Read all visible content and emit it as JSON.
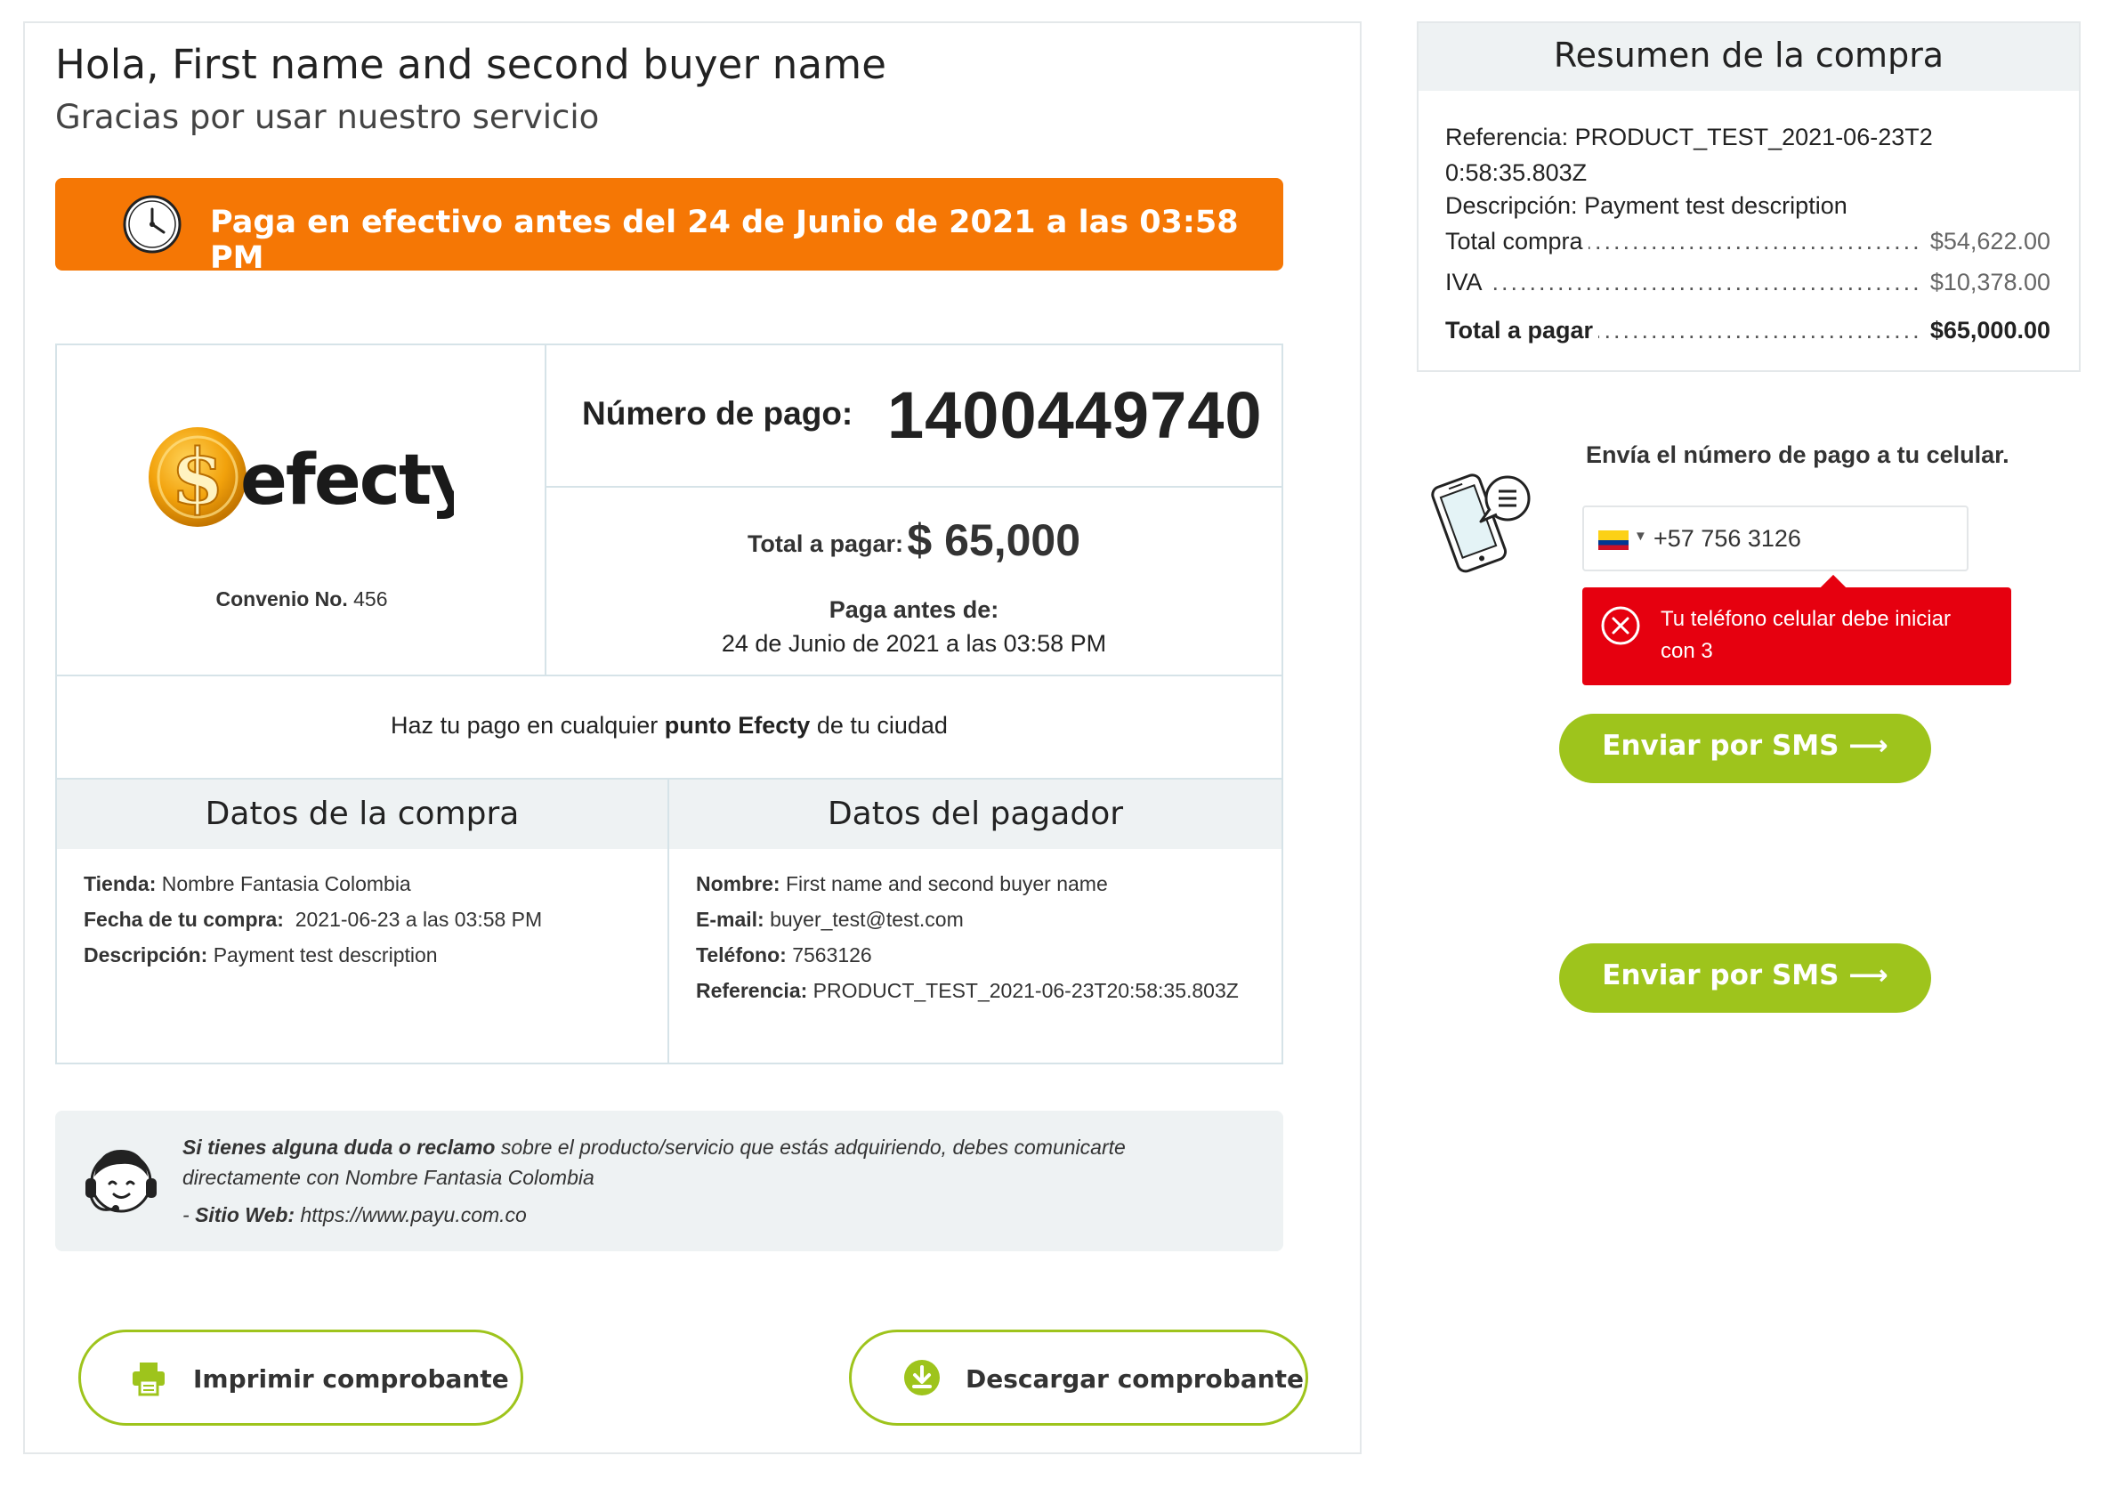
{
  "greeting": {
    "title": "Hola, First name and second buyer name",
    "subtitle": "Gracias por usar nuestro servicio"
  },
  "deadline": {
    "text": "Paga en efectivo antes del 24 de Junio de 2021 a las 03:58 PM",
    "color": "#f57705",
    "icon": "clock-icon"
  },
  "payment": {
    "logo_text": "efecty",
    "convenio_label": "Convenio No.",
    "convenio_value": "456",
    "numero_label": "Número de pago:",
    "numero_value": "1400449740",
    "total_label": "Total a pagar:",
    "total_value": "$ 65,000",
    "paga_antes_label": "Paga antes de:",
    "paga_antes_value": "24 de Junio de 2021 a las 03:58 PM",
    "where_pre": "Haz tu pago en cualquier",
    "where_bold": "punto Efecty",
    "where_post": "de tu ciudad"
  },
  "compra": {
    "title": "Datos de la compra",
    "rows": [
      {
        "label": "Tienda:",
        "value": "Nombre Fantasia Colombia"
      },
      {
        "label": "Fecha de tu compra:",
        "value": "2021-06-23 a las 03:58 PM"
      },
      {
        "label": "Descripción:",
        "value": "Payment test description"
      }
    ]
  },
  "pagador": {
    "title": "Datos del pagador",
    "rows": [
      {
        "label": "Nombre:",
        "value": "First name and second buyer name"
      },
      {
        "label": "E-mail:",
        "value": "buyer_test@test.com"
      },
      {
        "label": "Teléfono:",
        "value": "7563126"
      },
      {
        "label": "Referencia:",
        "value": "PRODUCT_TEST_2021-06-23T20:58:35.803Z"
      }
    ]
  },
  "help": {
    "bold": "Si tienes alguna duda o reclamo",
    "text": "sobre el producto/servicio que estás adquiriendo, debes comunicarte directamente con Nombre Fantasia Colombia",
    "web_prefix": "- ",
    "web_label": "Sitio Web:",
    "web_value": "https://www.payu.com.co"
  },
  "buttons": {
    "print": "Imprimir comprobante",
    "download": "Descargar comprobante",
    "accent": "#9ec41c"
  },
  "summary": {
    "title": "Resumen de la compra",
    "ref_label": "Referencia:",
    "ref_value": "PRODUCT_TEST_2021-06-23T20:58:35.803Z",
    "desc_label": "Descripción:",
    "desc_value": "Payment test description",
    "total_compra_label": "Total compra",
    "total_compra_value": "$54,622.00",
    "iva_label": "IVA",
    "iva_value": "$10,378.00",
    "total_pagar_label": "Total a pagar",
    "total_pagar_value": "$65,000.00"
  },
  "sms": {
    "title": "Envía el número de pago a tu celular.",
    "phone_value": "+57 756 3126",
    "error": "Tu teléfono celular debe iniciar con 3",
    "error_color": "#e6000f",
    "button": "Enviar por SMS",
    "arrow": "⟶"
  }
}
